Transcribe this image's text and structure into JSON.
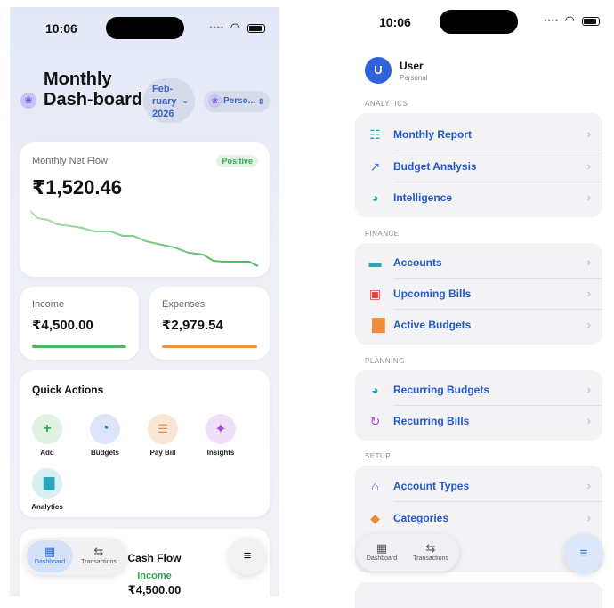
{
  "left_screen": {
    "status_time": "10:06",
    "header": {
      "title": "Monthly Dash-board",
      "month_line1": "Feb-",
      "month_line2": "ruary",
      "month_line3": "2026",
      "persona": "Perso..."
    },
    "net_flow": {
      "label": "Monthly Net Flow",
      "badge": "Positive",
      "amount": "₹1,520.46",
      "sparkline_color": "#5cc36a"
    },
    "income": {
      "label": "Income",
      "amount": "₹4,500.00",
      "color": "#4cbb5c"
    },
    "expenses": {
      "label": "Expenses",
      "amount": "₹2,979.54",
      "color": "#f0913a"
    },
    "quick_actions": {
      "title": "Quick Actions",
      "items": [
        {
          "label": "Add",
          "icon": "plus-icon",
          "color": "#3aa552"
        },
        {
          "label": "Budgets",
          "icon": "pie-chart-icon",
          "color": "#2f6fd6"
        },
        {
          "label": "Pay Bill",
          "icon": "document-icon",
          "color": "#ef8a3a"
        },
        {
          "label": "Insights",
          "icon": "sparkles-icon",
          "color": "#a24ad8"
        },
        {
          "label": "Analytics",
          "icon": "bar-chart-icon",
          "color": "#2aa6b8"
        }
      ]
    },
    "cash_flow": {
      "title": "Cash Flow",
      "income_label": "Income",
      "income_amount": "₹4,500.00"
    },
    "tabbar": {
      "tab1": "Dashboard",
      "tab2": "Transactions"
    }
  },
  "right_screen": {
    "status_time": "10:06",
    "user": {
      "initial": "U",
      "name": "User",
      "subtitle": "Personal"
    },
    "sections": {
      "analytics": {
        "header": "ANALYTICS",
        "items": [
          "Monthly Report",
          "Budget Analysis",
          "Intelligence"
        ]
      },
      "finance": {
        "header": "FINANCE",
        "items": [
          "Accounts",
          "Upcoming Bills",
          "Active Budgets"
        ]
      },
      "planning": {
        "header": "PLANNING",
        "items": [
          "Recurring Budgets",
          "Recurring Bills"
        ]
      },
      "setup": {
        "header": "SETUP",
        "items": [
          "Account Types",
          "Categories"
        ]
      }
    },
    "tabbar": {
      "tab1": "Dashboard",
      "tab2": "Transactions"
    }
  }
}
